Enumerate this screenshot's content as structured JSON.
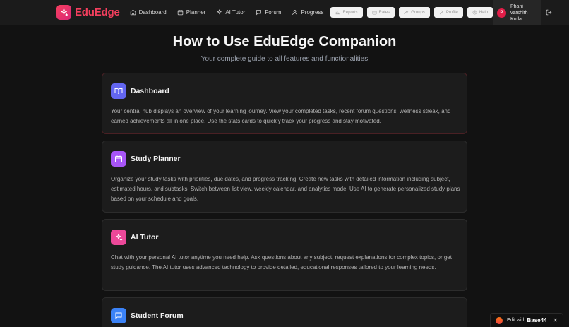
{
  "brand": {
    "name": "EduEdge",
    "logo_icon": "sparkles-icon",
    "color": "#f43f5e"
  },
  "nav": {
    "links": [
      {
        "label": "Dashboard",
        "icon": "home-icon"
      },
      {
        "label": "Planner",
        "icon": "calendar-icon"
      },
      {
        "label": "AI Tutor",
        "icon": "sparkles-icon"
      },
      {
        "label": "Forum",
        "icon": "message-icon"
      },
      {
        "label": "Progress",
        "icon": "user-icon"
      }
    ],
    "pills": [
      {
        "label": "Reports",
        "icon": "chart-icon"
      },
      {
        "label": "Rates",
        "icon": "calendar-icon"
      },
      {
        "label": "Groups",
        "icon": "users-icon"
      },
      {
        "label": "Profile",
        "icon": "user-icon"
      },
      {
        "label": "Help",
        "icon": "help-icon"
      }
    ]
  },
  "user": {
    "initial": "P",
    "name": "Phani varshith Kotla"
  },
  "hero": {
    "title": "How to Use EduEdge Companion",
    "subtitle": "Your complete guide to all features and functionalities"
  },
  "cards": [
    {
      "title": "Dashboard",
      "icon": "book-open-icon",
      "icon_color": "#6366f1",
      "description": "Your central hub displays an overview of your learning journey. View your completed tasks, recent forum questions, wellness streak, and earned achievements all in one place. Use the stats cards to quickly track your progress and stay motivated."
    },
    {
      "title": "Study Planner",
      "icon": "calendar-icon",
      "icon_color": "#a855f7",
      "description": "Organize your study tasks with priorities, due dates, and progress tracking. Create new tasks with detailed information including subject, estimated hours, and subtasks. Switch between list view, weekly calendar, and analytics mode. Use AI to generate personalized study plans based on your schedule and goals."
    },
    {
      "title": "AI Tutor",
      "icon": "sparkles-icon",
      "icon_color": "#ec4899",
      "description": "Chat with your personal AI tutor anytime you need help. Ask questions about any subject, request explanations for complex topics, or get study guidance. The AI tutor uses advanced technology to provide detailed, educational responses tailored to your learning needs."
    },
    {
      "title": "Student Forum",
      "icon": "message-square-icon",
      "icon_color": "#3b82f6",
      "description": ""
    }
  ],
  "badge": {
    "text": "Edit with",
    "brand": "Base44",
    "close": "✕"
  }
}
